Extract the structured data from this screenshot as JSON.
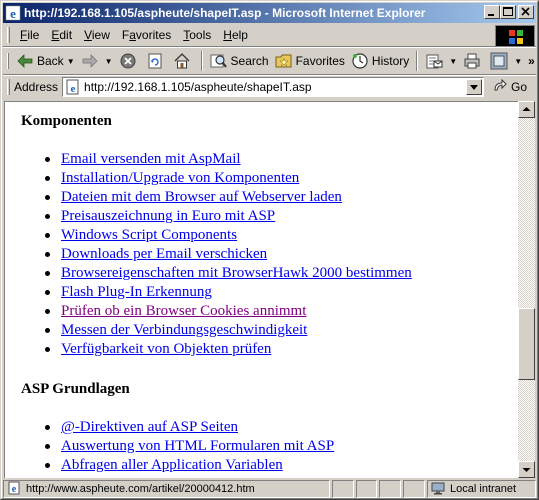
{
  "window": {
    "title": "http://192.168.1.105/aspheute/shapeIT.asp - Microsoft Internet Explorer",
    "minimize": "_",
    "restore": "❐",
    "close": "✕"
  },
  "menu": [
    "File",
    "Edit",
    "View",
    "Favorites",
    "Tools",
    "Help"
  ],
  "menu_underline": [
    "F",
    "E",
    "V",
    "a",
    "T",
    "H"
  ],
  "toolbar": {
    "back_label": "Back",
    "search_label": "Search",
    "favorites_label": "Favorites",
    "history_label": "History",
    "chevron": "»"
  },
  "address": {
    "label": "Address",
    "url": "http://192.168.1.105/aspheute/shapeIT.asp",
    "go_label": "Go"
  },
  "content": {
    "section1_title": "Komponenten",
    "section1_links": [
      {
        "text": "Email versenden mit AspMail",
        "visited": false
      },
      {
        "text": "Installation/Upgrade von Komponenten",
        "visited": false
      },
      {
        "text": "Dateien mit dem Browser auf Webserver laden",
        "visited": false
      },
      {
        "text": "Preisauszeichnung in Euro mit ASP",
        "visited": false
      },
      {
        "text": "Windows Script Components",
        "visited": false
      },
      {
        "text": "Downloads per Email verschicken",
        "visited": false
      },
      {
        "text": "Browsereigenschaften mit BrowserHawk 2000 bestimmen",
        "visited": false
      },
      {
        "text": "Flash Plug-In Erkennung",
        "visited": false
      },
      {
        "text": "Prüfen ob ein Browser Cookies annimmt",
        "visited": true
      },
      {
        "text": "Messen der Verbindungsgeschwindigkeit",
        "visited": false
      },
      {
        "text": "Verfügbarkeit von Objekten prüfen",
        "visited": false
      }
    ],
    "section2_title": "ASP Grundlagen",
    "section2_links": [
      {
        "text": "@-Direktiven auf ASP Seiten",
        "visited": false
      },
      {
        "text": "Auswertung von HTML Formularen mit ASP",
        "visited": false
      },
      {
        "text": "Abfragen aller Application Variablen",
        "visited": false
      }
    ]
  },
  "status": {
    "text": "http://www.aspheute.com/artikel/20000412.htm",
    "zone": "Local intranet"
  },
  "colors": {
    "title_gradient_start": "#0a246a",
    "title_gradient_end": "#a6caf0",
    "link": "#0000ee",
    "visited_link": "#800080",
    "chrome": "#d4d0c8"
  }
}
